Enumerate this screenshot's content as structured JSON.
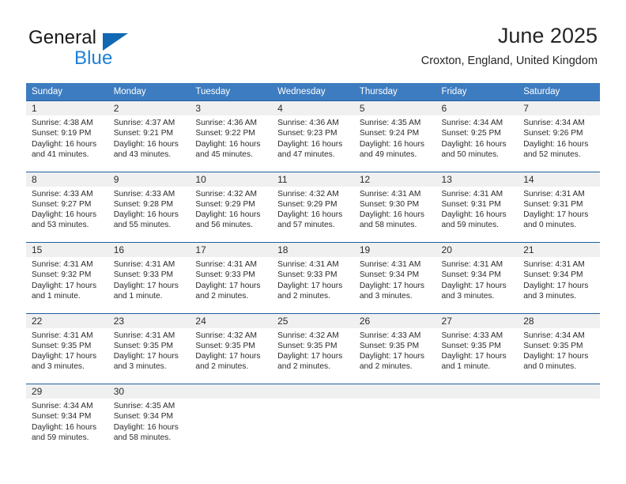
{
  "brand": {
    "name_part1": "General",
    "name_part2": "Blue",
    "triangle_icon": "blue-triangle-icon",
    "accent_color": "#1e7fd4"
  },
  "header": {
    "title": "June 2025",
    "subtitle": "Croxton, England, United Kingdom"
  },
  "theme": {
    "header_blue": "#3d7cc0",
    "rule_blue": "#1f5fa0",
    "date_band_gray": "#f0f0f0",
    "text": "#2b2b2b"
  },
  "calendar": {
    "weekday_headers": [
      "Sunday",
      "Monday",
      "Tuesday",
      "Wednesday",
      "Thursday",
      "Friday",
      "Saturday"
    ],
    "weeks": [
      {
        "dates": [
          "1",
          "2",
          "3",
          "4",
          "5",
          "6",
          "7"
        ],
        "details": [
          "Sunrise: 4:38 AM\nSunset: 9:19 PM\nDaylight: 16 hours\nand 41 minutes.",
          "Sunrise: 4:37 AM\nSunset: 9:21 PM\nDaylight: 16 hours\nand 43 minutes.",
          "Sunrise: 4:36 AM\nSunset: 9:22 PM\nDaylight: 16 hours\nand 45 minutes.",
          "Sunrise: 4:36 AM\nSunset: 9:23 PM\nDaylight: 16 hours\nand 47 minutes.",
          "Sunrise: 4:35 AM\nSunset: 9:24 PM\nDaylight: 16 hours\nand 49 minutes.",
          "Sunrise: 4:34 AM\nSunset: 9:25 PM\nDaylight: 16 hours\nand 50 minutes.",
          "Sunrise: 4:34 AM\nSunset: 9:26 PM\nDaylight: 16 hours\nand 52 minutes."
        ]
      },
      {
        "dates": [
          "8",
          "9",
          "10",
          "11",
          "12",
          "13",
          "14"
        ],
        "details": [
          "Sunrise: 4:33 AM\nSunset: 9:27 PM\nDaylight: 16 hours\nand 53 minutes.",
          "Sunrise: 4:33 AM\nSunset: 9:28 PM\nDaylight: 16 hours\nand 55 minutes.",
          "Sunrise: 4:32 AM\nSunset: 9:29 PM\nDaylight: 16 hours\nand 56 minutes.",
          "Sunrise: 4:32 AM\nSunset: 9:29 PM\nDaylight: 16 hours\nand 57 minutes.",
          "Sunrise: 4:31 AM\nSunset: 9:30 PM\nDaylight: 16 hours\nand 58 minutes.",
          "Sunrise: 4:31 AM\nSunset: 9:31 PM\nDaylight: 16 hours\nand 59 minutes.",
          "Sunrise: 4:31 AM\nSunset: 9:31 PM\nDaylight: 17 hours\nand 0 minutes."
        ]
      },
      {
        "dates": [
          "15",
          "16",
          "17",
          "18",
          "19",
          "20",
          "21"
        ],
        "details": [
          "Sunrise: 4:31 AM\nSunset: 9:32 PM\nDaylight: 17 hours\nand 1 minute.",
          "Sunrise: 4:31 AM\nSunset: 9:33 PM\nDaylight: 17 hours\nand 1 minute.",
          "Sunrise: 4:31 AM\nSunset: 9:33 PM\nDaylight: 17 hours\nand 2 minutes.",
          "Sunrise: 4:31 AM\nSunset: 9:33 PM\nDaylight: 17 hours\nand 2 minutes.",
          "Sunrise: 4:31 AM\nSunset: 9:34 PM\nDaylight: 17 hours\nand 3 minutes.",
          "Sunrise: 4:31 AM\nSunset: 9:34 PM\nDaylight: 17 hours\nand 3 minutes.",
          "Sunrise: 4:31 AM\nSunset: 9:34 PM\nDaylight: 17 hours\nand 3 minutes."
        ]
      },
      {
        "dates": [
          "22",
          "23",
          "24",
          "25",
          "26",
          "27",
          "28"
        ],
        "details": [
          "Sunrise: 4:31 AM\nSunset: 9:35 PM\nDaylight: 17 hours\nand 3 minutes.",
          "Sunrise: 4:31 AM\nSunset: 9:35 PM\nDaylight: 17 hours\nand 3 minutes.",
          "Sunrise: 4:32 AM\nSunset: 9:35 PM\nDaylight: 17 hours\nand 2 minutes.",
          "Sunrise: 4:32 AM\nSunset: 9:35 PM\nDaylight: 17 hours\nand 2 minutes.",
          "Sunrise: 4:33 AM\nSunset: 9:35 PM\nDaylight: 17 hours\nand 2 minutes.",
          "Sunrise: 4:33 AM\nSunset: 9:35 PM\nDaylight: 17 hours\nand 1 minute.",
          "Sunrise: 4:34 AM\nSunset: 9:35 PM\nDaylight: 17 hours\nand 0 minutes."
        ]
      },
      {
        "dates": [
          "29",
          "30",
          "",
          "",
          "",
          "",
          ""
        ],
        "details": [
          "Sunrise: 4:34 AM\nSunset: 9:34 PM\nDaylight: 16 hours\nand 59 minutes.",
          "Sunrise: 4:35 AM\nSunset: 9:34 PM\nDaylight: 16 hours\nand 58 minutes.",
          "",
          "",
          "",
          "",
          ""
        ]
      }
    ]
  }
}
